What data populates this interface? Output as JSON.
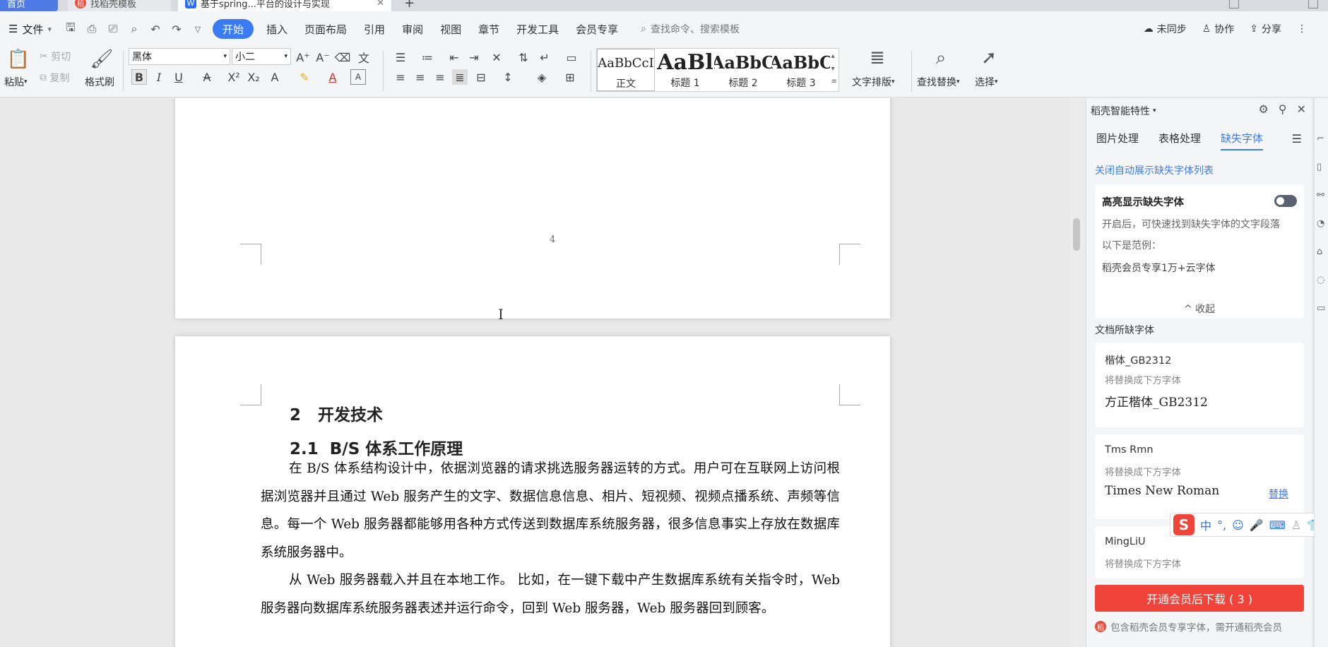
{
  "tabs": {
    "home": "首页",
    "template": "找稻壳模板",
    "doc": "基于spring...平台的设计与实现",
    "add": "+"
  },
  "menu": {
    "file": "文件",
    "items": [
      "开始",
      "插入",
      "页面布局",
      "引用",
      "审阅",
      "视图",
      "章节",
      "开发工具",
      "会员专享"
    ],
    "search_placeholder": "查找命令、搜索模板",
    "right": [
      "未同步",
      "协作",
      "分享"
    ]
  },
  "ribbon": {
    "paste": "粘贴",
    "cut": "剪切",
    "copy": "复制",
    "format_painter": "格式刷",
    "font_name": "黑体",
    "font_size": "小二",
    "styles": [
      {
        "sample": "AaBbCcI",
        "name": "正文"
      },
      {
        "sample": "AaBl",
        "name": "标题 1"
      },
      {
        "sample": "AaBbC",
        "name": "标题 2"
      },
      {
        "sample": "AaBbC",
        "name": "标题 3"
      }
    ],
    "text_layout": "文字排版",
    "find_replace": "查找替换",
    "select": "选择"
  },
  "document": {
    "page_number": "4",
    "heading1_num": "2",
    "heading1": "开发技术",
    "heading2_num": "2.1",
    "heading2": "B/S 体系工作原理",
    "para1": "在 B/S 体系结构设计中，依据浏览器的请求挑选服务器运转的方式。用户可在互联网上访问根据浏览器并且通过 Web 服务产生的文字、数据信息信息、相片、短视频、视频点播系统、声频等信息。每一个 Web 服务器都能够用各种方式传送到数据库系统服务器，很多信息事实上存放在数据库系统服务器中。",
    "para2": "从 Web 服务器载入并且在本地工作。 比如，在一键下载中产生数据库系统有关指令时，Web 服务器向数据库系统服务器表述并运行命令，回到 Web 服务器，Web 服务器回到顾客。"
  },
  "panel": {
    "title": "稻壳智能特性",
    "tabs": [
      "图片处理",
      "表格处理",
      "缺失字体"
    ],
    "active_tab": "缺失字体",
    "link": "关闭自动展示缺失字体列表",
    "highlight_title": "高亮显示缺失字体",
    "highlight_desc1": "开启后，可快速找到缺失字体的文字段落",
    "highlight_desc2": "以下是范例：",
    "highlight_desc3": "稻壳会员专享1万+云字体",
    "collapse": "收起",
    "section": "文档所缺字体",
    "fonts": [
      {
        "name": "楷体_GB2312",
        "replace_hint": "将替换成下方字体",
        "target": "方正楷体_GB2312",
        "action": ""
      },
      {
        "name": "Tms Rmn",
        "replace_hint": "将替换成下方字体",
        "target": "Times New Roman",
        "action": "替换"
      },
      {
        "name": "MingLiU",
        "replace_hint": "将替换成下方字体",
        "target": "",
        "action": ""
      }
    ],
    "buy_button": "开通会员后下载 ( 3 )",
    "note": "包含稻壳会员专享字体，需开通稻壳会员"
  },
  "ime": {
    "logo": "S",
    "lang": "中"
  },
  "colors": {
    "accent": "#3b7bf2",
    "buy": "#f0443a"
  }
}
